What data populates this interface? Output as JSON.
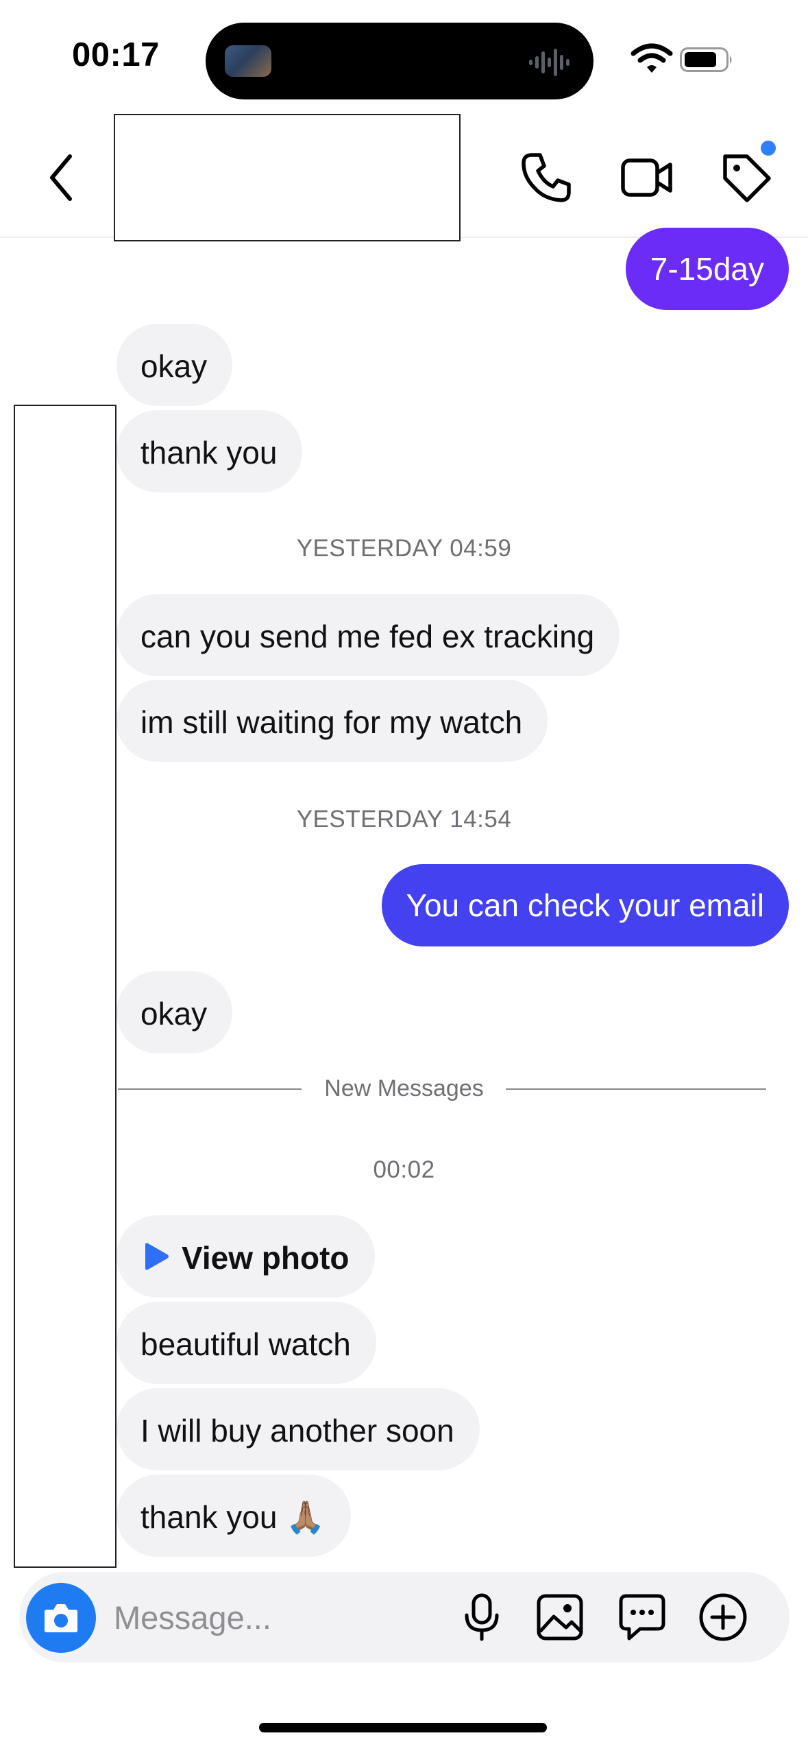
{
  "status_bar": {
    "time": "00:17"
  },
  "header": {
    "contact_name": ""
  },
  "messages": [
    {
      "id": "m1",
      "direction": "outgoing",
      "text": "7-15day"
    },
    {
      "id": "m2",
      "direction": "incoming",
      "text": "okay"
    },
    {
      "id": "m3",
      "direction": "incoming",
      "text": "thank you"
    },
    {
      "id": "ts1",
      "type": "timestamp",
      "text": "YESTERDAY 04:59"
    },
    {
      "id": "m4",
      "direction": "incoming",
      "text": "can you send me fed ex tracking"
    },
    {
      "id": "m5",
      "direction": "incoming",
      "text": "im still waiting for my watch"
    },
    {
      "id": "ts2",
      "type": "timestamp",
      "text": "YESTERDAY 14:54"
    },
    {
      "id": "m6",
      "direction": "outgoing",
      "text": "You can check your email"
    },
    {
      "id": "m7",
      "direction": "incoming",
      "text": "okay"
    },
    {
      "id": "div1",
      "type": "divider",
      "text": "New Messages"
    },
    {
      "id": "ts3",
      "type": "timestamp",
      "text": "00:02"
    },
    {
      "id": "m8",
      "direction": "incoming",
      "text": "View photo",
      "icon": "play-icon"
    },
    {
      "id": "m9",
      "direction": "incoming",
      "text": "beautiful watch"
    },
    {
      "id": "m10",
      "direction": "incoming",
      "text": "I will buy another soon"
    },
    {
      "id": "m11",
      "direction": "incoming",
      "text": "thank you 🙏🏽"
    }
  ],
  "composer": {
    "placeholder": "Message...",
    "value": ""
  },
  "icons": {
    "header": [
      "back-chevron-icon",
      "phone-icon",
      "video-camera-icon",
      "tag-icon"
    ],
    "composer": [
      "camera-icon",
      "microphone-icon",
      "gallery-icon",
      "sticker-icon",
      "plus-icon"
    ]
  },
  "colors": {
    "outgoing_bubble_1": "#6a2cf6",
    "outgoing_bubble_2": "#4341f0",
    "incoming_bubble": "#f2f2f4",
    "camera_button": "#1f7bf2",
    "notification_dot": "#2f80ff",
    "view_photo_icon": "#2f6ff5"
  }
}
